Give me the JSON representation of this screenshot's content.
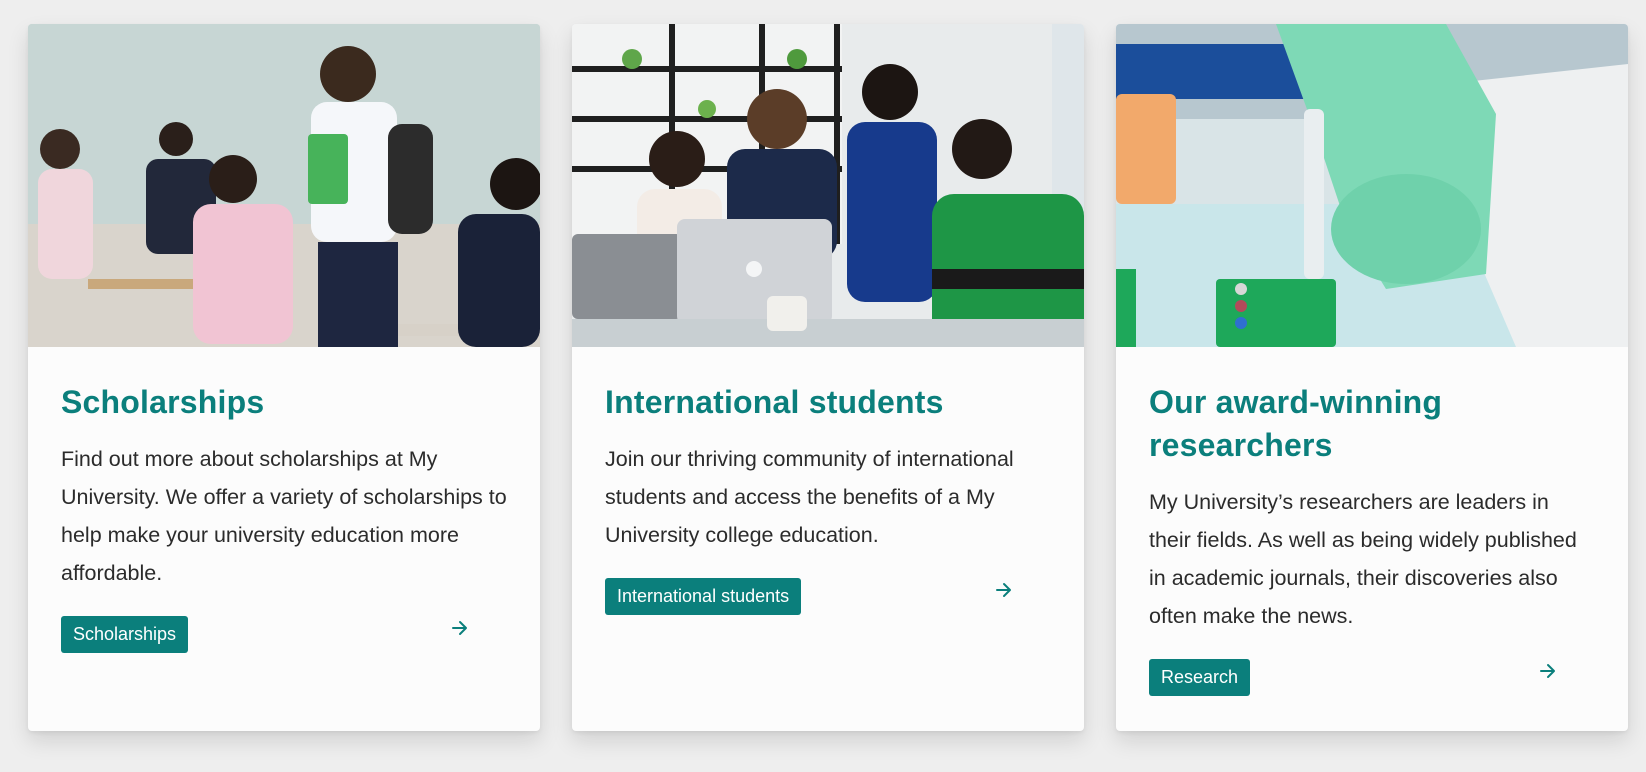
{
  "cards": [
    {
      "image_alt": "Students studying in a classroom",
      "title": "Scholarships",
      "text": "Find out more about scholarships at My University. We offer a variety of scholarships to help make your university education more affordable.",
      "button_label": "Scholarships",
      "arrow_icon": "arrow-right-icon"
    },
    {
      "image_alt": "Group of students looking at a laptop",
      "title": "International students",
      "text": "Join our thriving community of international students and access the benefits of a My University college education.",
      "button_label": "International students",
      "arrow_icon": "arrow-right-icon"
    },
    {
      "image_alt": "Researcher using a pipette in a lab",
      "title": "Our award-winning researchers",
      "text": "My University’s researchers are leaders in their fields. As well as being widely published in academic journals, their discoveries also often make the news.",
      "button_label": "Research",
      "arrow_icon": "arrow-right-icon"
    }
  ],
  "colors": {
    "accent": "#0b7f7c",
    "page_background": "#eeeeee",
    "card_background": "#fcfcfc",
    "body_text": "#2b2b2b"
  }
}
